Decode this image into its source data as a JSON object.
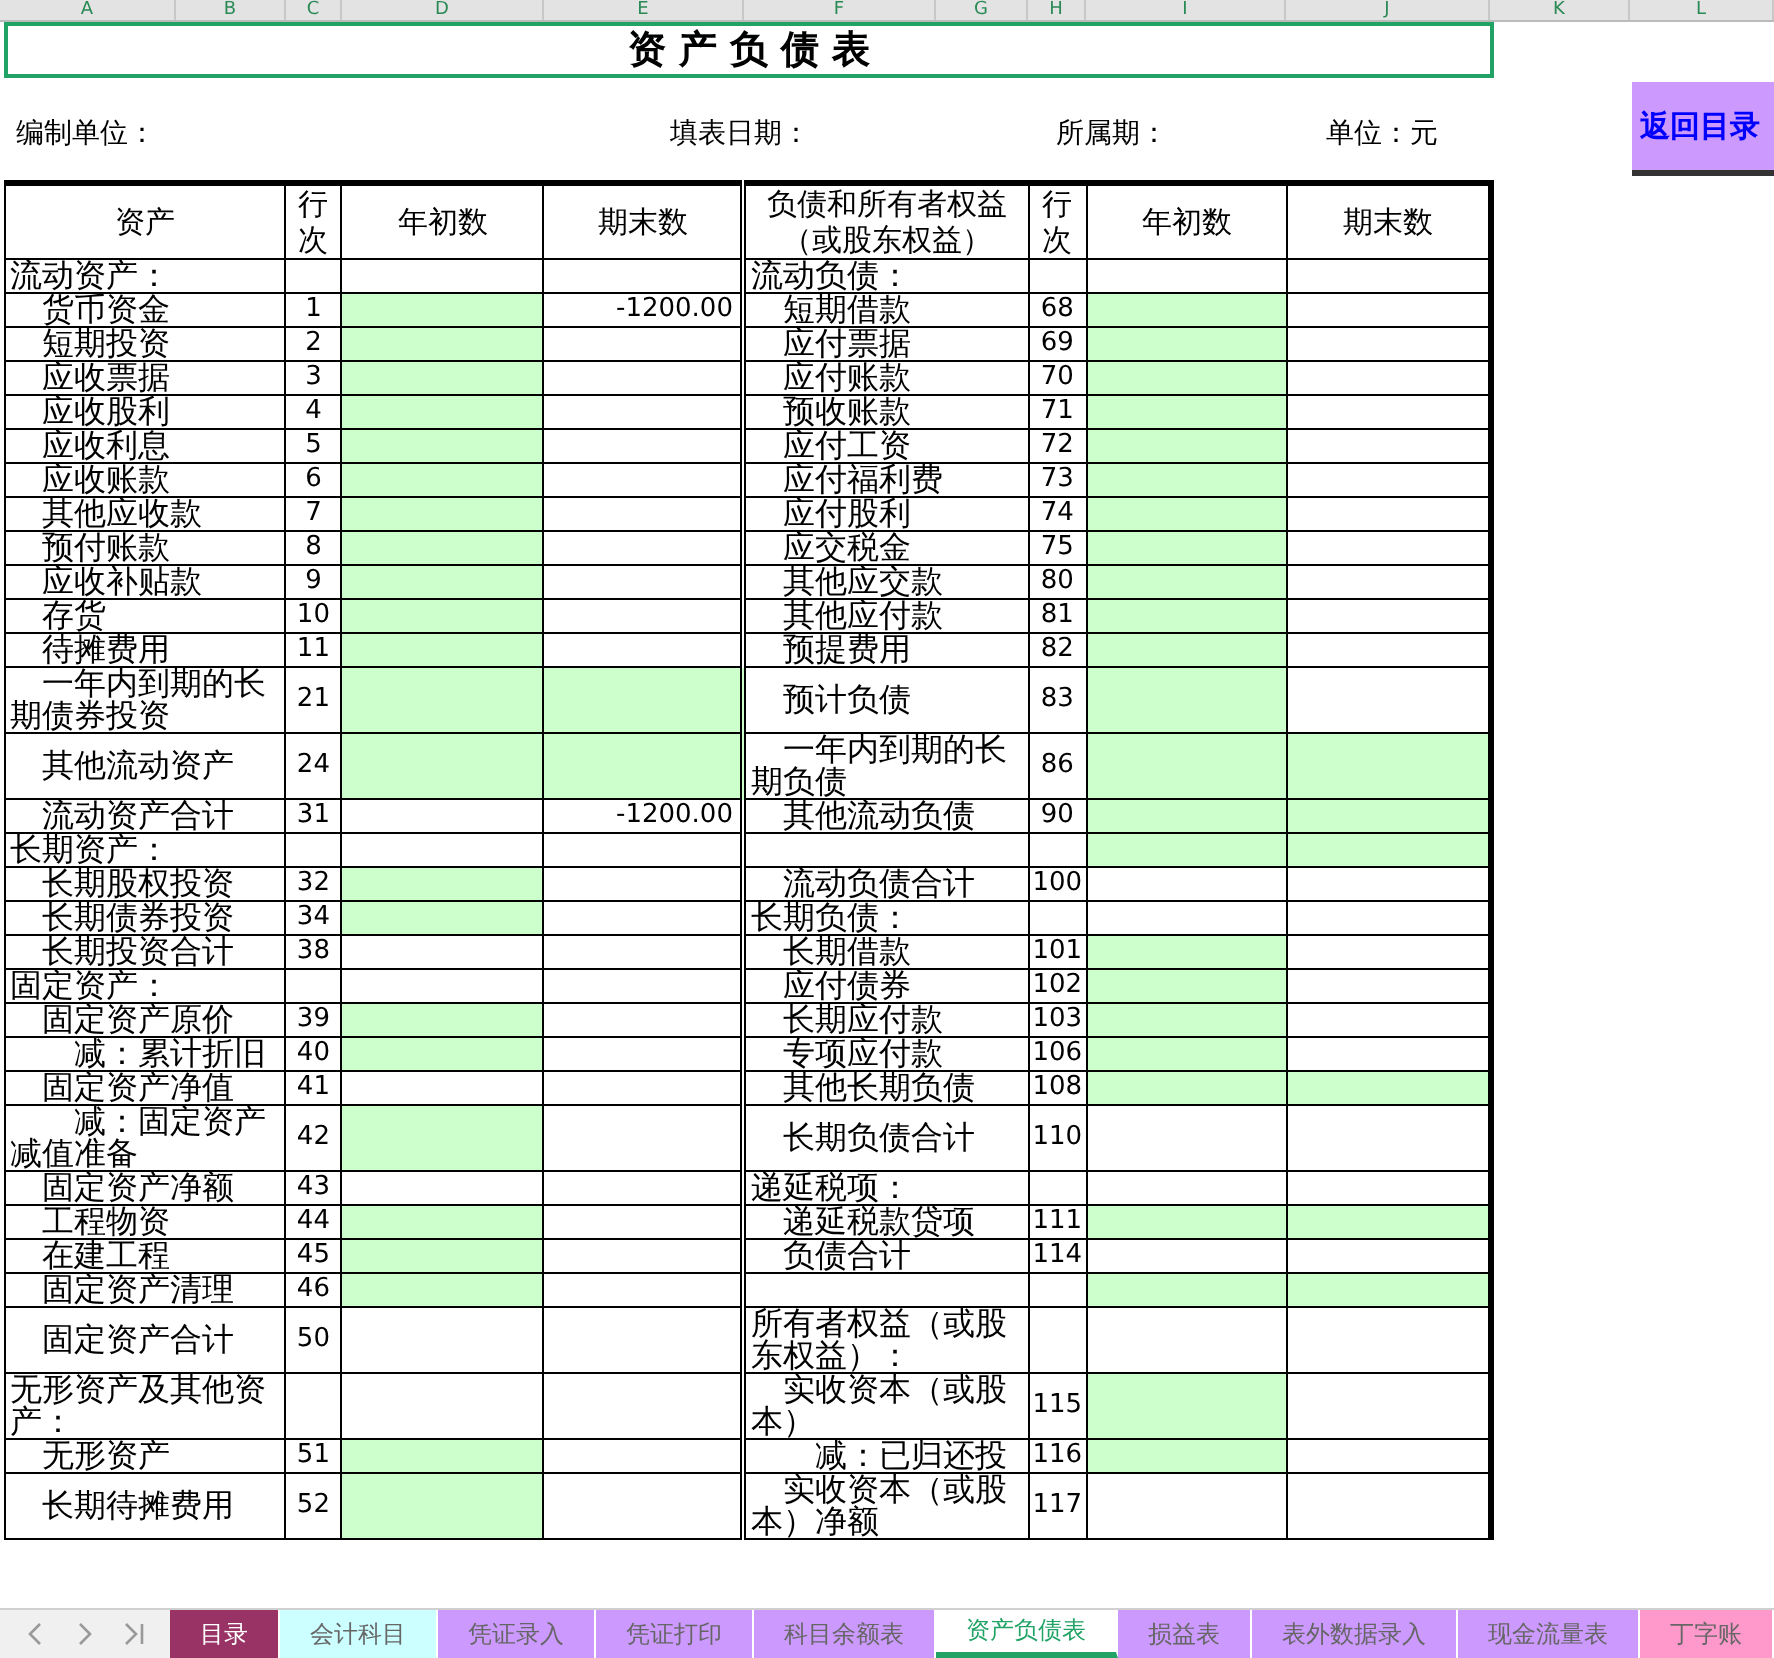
{
  "column_letters": [
    "A",
    "B",
    "C",
    "D",
    "E",
    "F",
    "G",
    "H",
    "I",
    "J",
    "K",
    "L"
  ],
  "title": "资 产 负 债 表",
  "info": [
    "编制单位：",
    "填表日期：",
    "所属期：",
    "单位：元"
  ],
  "back_button": "返回目录",
  "table": {
    "columns": [
      "资产",
      "行次",
      "年初数",
      "期末数",
      "负债和所有者权益（或股东权益）",
      "行次",
      "年初数",
      "期末数"
    ],
    "rows": [
      {
        "left": {
          "kind": "section",
          "label": "流动资产：",
          "begin": {
            "input": false
          },
          "end": {
            "input": false
          }
        },
        "right": {
          "kind": "section",
          "label": "流动负债：",
          "begin": {
            "input": false
          },
          "end": {
            "input": false
          }
        }
      },
      {
        "left": {
          "kind": "item",
          "label": "货币资金",
          "line": "1",
          "begin": {
            "input": true
          },
          "end": {
            "input": false,
            "value": "-1200.00"
          }
        },
        "right": {
          "kind": "item",
          "label": "短期借款",
          "line": "68",
          "begin": {
            "input": true
          },
          "end": {
            "input": false
          }
        }
      },
      {
        "left": {
          "kind": "item",
          "label": "短期投资",
          "line": "2",
          "begin": {
            "input": true
          },
          "end": {
            "input": false
          }
        },
        "right": {
          "kind": "item",
          "label": "应付票据",
          "line": "69",
          "begin": {
            "input": true
          },
          "end": {
            "input": false
          }
        }
      },
      {
        "left": {
          "kind": "item",
          "label": "应收票据",
          "line": "3",
          "begin": {
            "input": true
          },
          "end": {
            "input": false
          }
        },
        "right": {
          "kind": "item",
          "label": "应付账款",
          "line": "70",
          "begin": {
            "input": true
          },
          "end": {
            "input": false
          }
        }
      },
      {
        "left": {
          "kind": "item",
          "label": "应收股利",
          "line": "4",
          "begin": {
            "input": true
          },
          "end": {
            "input": false
          }
        },
        "right": {
          "kind": "item",
          "label": "预收账款",
          "line": "71",
          "begin": {
            "input": true
          },
          "end": {
            "input": false
          }
        }
      },
      {
        "left": {
          "kind": "item",
          "label": "应收利息",
          "line": "5",
          "begin": {
            "input": true
          },
          "end": {
            "input": false
          }
        },
        "right": {
          "kind": "item",
          "label": "应付工资",
          "line": "72",
          "begin": {
            "input": true
          },
          "end": {
            "input": false
          }
        }
      },
      {
        "left": {
          "kind": "item",
          "label": "应收账款",
          "line": "6",
          "begin": {
            "input": true
          },
          "end": {
            "input": false
          }
        },
        "right": {
          "kind": "item",
          "label": "应付福利费",
          "line": "73",
          "begin": {
            "input": true
          },
          "end": {
            "input": false
          }
        }
      },
      {
        "left": {
          "kind": "item",
          "label": "其他应收款",
          "line": "7",
          "begin": {
            "input": true
          },
          "end": {
            "input": false
          }
        },
        "right": {
          "kind": "item",
          "label": "应付股利",
          "line": "74",
          "begin": {
            "input": true
          },
          "end": {
            "input": false
          }
        }
      },
      {
        "left": {
          "kind": "item",
          "label": "预付账款",
          "line": "8",
          "begin": {
            "input": true
          },
          "end": {
            "input": false
          }
        },
        "right": {
          "kind": "item",
          "label": "应交税金",
          "line": "75",
          "begin": {
            "input": true
          },
          "end": {
            "input": false
          }
        }
      },
      {
        "left": {
          "kind": "item",
          "label": "应收补贴款",
          "line": "9",
          "begin": {
            "input": true
          },
          "end": {
            "input": false
          }
        },
        "right": {
          "kind": "item",
          "label": "其他应交款",
          "line": "80",
          "begin": {
            "input": true
          },
          "end": {
            "input": false
          }
        }
      },
      {
        "left": {
          "kind": "item",
          "label": "存货",
          "line": "10",
          "begin": {
            "input": true
          },
          "end": {
            "input": false
          }
        },
        "right": {
          "kind": "item",
          "label": "其他应付款",
          "line": "81",
          "begin": {
            "input": true
          },
          "end": {
            "input": false
          }
        }
      },
      {
        "left": {
          "kind": "item",
          "label": "待摊费用",
          "line": "11",
          "begin": {
            "input": true
          },
          "end": {
            "input": false
          }
        },
        "right": {
          "kind": "item",
          "label": "预提费用",
          "line": "82",
          "begin": {
            "input": true
          },
          "end": {
            "input": false
          }
        }
      },
      {
        "left": {
          "kind": "item",
          "label": "一年内到期的长期债券投资",
          "line": "21",
          "begin": {
            "input": true
          },
          "end": {
            "input": true
          }
        },
        "right": {
          "kind": "item",
          "label": "预计负债",
          "line": "83",
          "begin": {
            "input": true
          },
          "end": {
            "input": false
          }
        }
      },
      {
        "left": {
          "kind": "item",
          "label": "其他流动资产",
          "line": "24",
          "begin": {
            "input": true
          },
          "end": {
            "input": true
          }
        },
        "right": {
          "kind": "item",
          "label": "一年内到期的长期负债",
          "line": "86",
          "begin": {
            "input": true
          },
          "end": {
            "input": true
          }
        }
      },
      {
        "left": {
          "kind": "item",
          "label": "流动资产合计",
          "line": "31",
          "begin": {
            "input": false
          },
          "end": {
            "input": false,
            "value": "-1200.00"
          }
        },
        "right": {
          "kind": "item",
          "label": "其他流动负债",
          "line": "90",
          "begin": {
            "input": true
          },
          "end": {
            "input": true
          }
        }
      },
      {
        "left": {
          "kind": "section",
          "label": "长期资产：",
          "begin": {
            "input": false
          },
          "end": {
            "input": false
          }
        },
        "right": {
          "kind": "blank",
          "begin": {
            "input": true
          },
          "end": {
            "input": true
          }
        }
      },
      {
        "left": {
          "kind": "item",
          "label": "长期股权投资",
          "line": "32",
          "begin": {
            "input": true
          },
          "end": {
            "input": false
          }
        },
        "right": {
          "kind": "item",
          "label": "流动负债合计",
          "line": "100",
          "begin": {
            "input": false
          },
          "end": {
            "input": false
          }
        }
      },
      {
        "left": {
          "kind": "item",
          "label": "长期债券投资",
          "line": "34",
          "begin": {
            "input": true
          },
          "end": {
            "input": false
          }
        },
        "right": {
          "kind": "section",
          "label": "长期负债：",
          "begin": {
            "input": false
          },
          "end": {
            "input": false
          }
        }
      },
      {
        "left": {
          "kind": "item",
          "label": "长期投资合计",
          "line": "38",
          "begin": {
            "input": false
          },
          "end": {
            "input": false
          }
        },
        "right": {
          "kind": "item",
          "label": "长期借款",
          "line": "101",
          "begin": {
            "input": true
          },
          "end": {
            "input": false
          }
        }
      },
      {
        "left": {
          "kind": "section",
          "label": "固定资产：",
          "begin": {
            "input": false
          },
          "end": {
            "input": false
          }
        },
        "right": {
          "kind": "item",
          "label": "应付债券",
          "line": "102",
          "begin": {
            "input": true
          },
          "end": {
            "input": false
          }
        }
      },
      {
        "left": {
          "kind": "item",
          "label": "固定资产原价",
          "line": "39",
          "begin": {
            "input": true
          },
          "end": {
            "input": false
          }
        },
        "right": {
          "kind": "item",
          "label": "长期应付款",
          "line": "103",
          "begin": {
            "input": true
          },
          "end": {
            "input": false
          }
        }
      },
      {
        "left": {
          "kind": "deduction",
          "label": "减：累计折旧",
          "line": "40",
          "begin": {
            "input": true
          },
          "end": {
            "input": false
          }
        },
        "right": {
          "kind": "item",
          "label": "专项应付款",
          "line": "106",
          "begin": {
            "input": true
          },
          "end": {
            "input": false
          }
        }
      },
      {
        "left": {
          "kind": "item",
          "label": "固定资产净值",
          "line": "41",
          "begin": {
            "input": false
          },
          "end": {
            "input": false
          }
        },
        "right": {
          "kind": "item",
          "label": "其他长期负债",
          "line": "108",
          "begin": {
            "input": true
          },
          "end": {
            "input": true
          }
        }
      },
      {
        "left": {
          "kind": "deduction",
          "label": "减：固定资产减值准备",
          "line": "42",
          "begin": {
            "input": true
          },
          "end": {
            "input": false
          }
        },
        "right": {
          "kind": "item",
          "label": "长期负债合计",
          "line": "110",
          "begin": {
            "input": false
          },
          "end": {
            "input": false
          }
        }
      },
      {
        "left": {
          "kind": "item",
          "label": "固定资产净额",
          "line": "43",
          "begin": {
            "input": false
          },
          "end": {
            "input": false
          }
        },
        "right": {
          "kind": "section",
          "label": "递延税项：",
          "begin": {
            "input": false
          },
          "end": {
            "input": false
          }
        }
      },
      {
        "left": {
          "kind": "item",
          "label": "工程物资",
          "line": "44",
          "begin": {
            "input": true
          },
          "end": {
            "input": false
          }
        },
        "right": {
          "kind": "item",
          "label": "递延税款贷项",
          "line": "111",
          "begin": {
            "input": true
          },
          "end": {
            "input": true
          }
        }
      },
      {
        "left": {
          "kind": "item",
          "label": "在建工程",
          "line": "45",
          "begin": {
            "input": true
          },
          "end": {
            "input": false
          }
        },
        "right": {
          "kind": "item",
          "label": "负债合计",
          "line": "114",
          "begin": {
            "input": false
          },
          "end": {
            "input": false
          }
        }
      },
      {
        "left": {
          "kind": "item",
          "label": "固定资产清理",
          "line": "46",
          "begin": {
            "input": true
          },
          "end": {
            "input": false
          }
        },
        "right": {
          "kind": "blank",
          "begin": {
            "input": true
          },
          "end": {
            "input": true
          }
        }
      },
      {
        "left": {
          "kind": "item",
          "label": "固定资产合计",
          "line": "50",
          "begin": {
            "input": false
          },
          "end": {
            "input": false
          }
        },
        "right": {
          "kind": "section",
          "label": "所有者权益（或股东权益）：",
          "begin": {
            "input": false
          },
          "end": {
            "input": false
          }
        }
      },
      {
        "left": {
          "kind": "section",
          "label": "无形资产及其他资产：",
          "begin": {
            "input": false
          },
          "end": {
            "input": false
          }
        },
        "right": {
          "kind": "item",
          "label": "实收资本（或股本）",
          "line": "115",
          "begin": {
            "input": true
          },
          "end": {
            "input": false
          }
        }
      },
      {
        "left": {
          "kind": "item",
          "label": "无形资产",
          "line": "51",
          "begin": {
            "input": true
          },
          "end": {
            "input": false
          }
        },
        "right": {
          "kind": "deduction",
          "label": "减：已归还投",
          "line": "116",
          "begin": {
            "input": true
          },
          "end": {
            "input": false
          }
        }
      },
      {
        "left": {
          "kind": "item",
          "label": "长期待摊费用",
          "line": "52",
          "begin": {
            "input": true
          },
          "end": {
            "input": false
          }
        },
        "right": {
          "kind": "item",
          "label": "实收资本（或股本）净额",
          "line": "117",
          "begin": {
            "input": false
          },
          "end": {
            "input": false
          }
        }
      }
    ]
  },
  "sheet_tabs": [
    {
      "label": "目录",
      "color": "#993366",
      "selected": false
    },
    {
      "label": "会计科目",
      "color": "#ccffff",
      "selected": false
    },
    {
      "label": "凭证录入",
      "color": "#cc99ff",
      "selected": false
    },
    {
      "label": "凭证打印",
      "color": "#cc99ff",
      "selected": false
    },
    {
      "label": "科目余额表",
      "color": "#cc99ff",
      "selected": false
    },
    {
      "label": "资产负债表",
      "color": "#ffffff",
      "selected": true
    },
    {
      "label": "损益表",
      "color": "#cc99ff",
      "selected": false
    },
    {
      "label": "表外数据录入",
      "color": "#cc99ff",
      "selected": false
    },
    {
      "label": "现金流量表",
      "color": "#cc99ff",
      "selected": false
    },
    {
      "label": "丁字账",
      "color": "#ff99cc",
      "selected": false
    }
  ]
}
